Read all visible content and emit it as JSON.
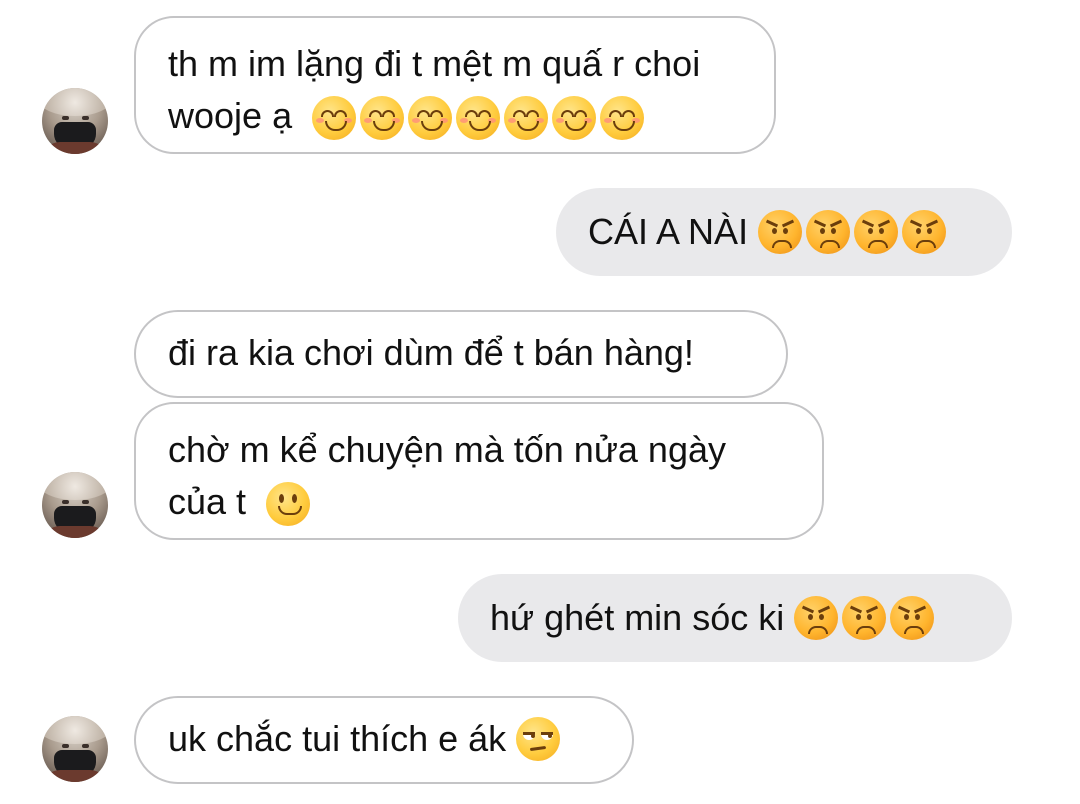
{
  "colors": {
    "incoming_border": "#c4c4c6",
    "outgoing_bg": "#e9e9eb",
    "text": "#111111"
  },
  "messages": [
    {
      "from": "them",
      "line1": "th m im lặng đi t mệt m quấ r choi",
      "line2": "wooje ạ",
      "emoji": "smiling-face-with-smiling-eyes",
      "emoji_count": 7
    },
    {
      "from": "me",
      "text": "CÁI A NÀI",
      "emoji": "angry-face",
      "emoji_count": 4
    },
    {
      "from": "them",
      "text": "đi ra kia chơi dùm để t bán hàng!"
    },
    {
      "from": "them",
      "line1": "chờ m kể chuyện mà tốn nửa ngày",
      "line2": "của t",
      "emoji": "slightly-smiling-face",
      "emoji_count": 1
    },
    {
      "from": "me",
      "text": "hứ ghét min sóc ki",
      "emoji": "angry-face",
      "emoji_count": 3
    },
    {
      "from": "them",
      "text": "uk chắc tui thích e ák",
      "emoji": "unamused-face",
      "emoji_count": 1
    }
  ]
}
